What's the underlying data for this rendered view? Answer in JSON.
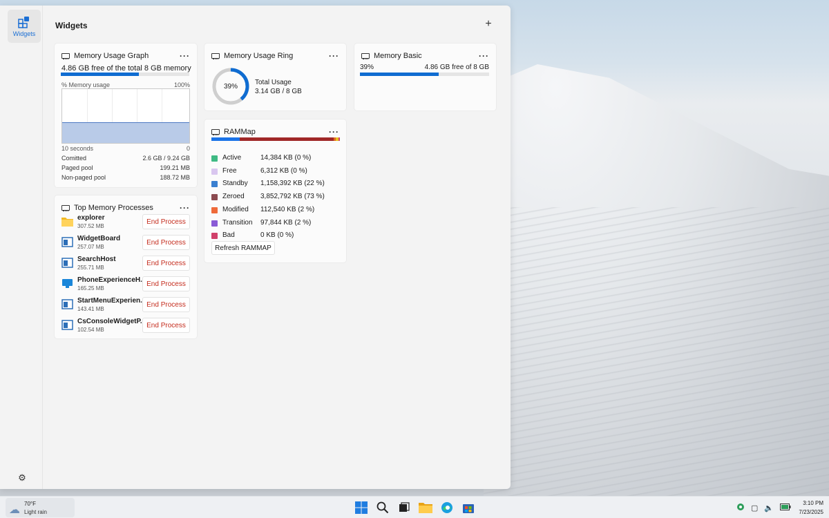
{
  "panel": {
    "title": "Widgets",
    "rail_label": "Widgets",
    "add_icon": "plus-icon",
    "settings_icon": "gear-icon"
  },
  "memory_graph": {
    "title": "Memory Usage Graph",
    "free_text": "4.86 GB free of the total 8 GB memory",
    "used_fraction": 0.61,
    "y_label": "% Memory usage",
    "y_max": "100%",
    "x_label": "10 seconds",
    "x_min": "0",
    "level_percent": 39,
    "stats": [
      {
        "label": "Comitted",
        "value": "2.6 GB / 9.24 GB"
      },
      {
        "label": "Paged pool",
        "value": "199.21 MB"
      },
      {
        "label": "Non-paged pool",
        "value": "188.72 MB"
      }
    ]
  },
  "memory_ring": {
    "title": "Memory Usage Ring",
    "percent_label": "39%",
    "percent": 39,
    "label": "Total Usage",
    "value": "3.14 GB / 8 GB"
  },
  "memory_basic": {
    "title": "Memory Basic",
    "percent_label": "39%",
    "free_text": "4.86 GB free of 8 GB",
    "used_fraction": 0.61
  },
  "top_processes": {
    "title": "Top Memory Processes",
    "end_label": "End Process",
    "items": [
      {
        "name": "explorer",
        "memory": "307.52 MB",
        "icon": "folder-icon"
      },
      {
        "name": "WidgetBoard",
        "memory": "257.07 MB",
        "icon": "app-window-icon"
      },
      {
        "name": "SearchHost",
        "memory": "255.71 MB",
        "icon": "app-window-icon"
      },
      {
        "name": "PhoneExperienceH...",
        "memory": "165.25 MB",
        "icon": "phone-link-icon"
      },
      {
        "name": "StartMenuExperien...",
        "memory": "143.41 MB",
        "icon": "app-window-icon"
      },
      {
        "name": "CsConsoleWidgetP...",
        "memory": "102.54 MB",
        "icon": "app-window-icon"
      }
    ]
  },
  "rammap": {
    "title": "RAMMap",
    "refresh_label": "Refresh RAMMAP",
    "items": [
      {
        "name": "Active",
        "value": "14,384 KB (0 %)",
        "color": "#3fba84",
        "bar_color": "#1a73e8",
        "share": 0.22
      },
      {
        "name": "Free",
        "value": "6,312 KB (0 %)",
        "color": "#d9c6ef",
        "bar_color": "#0020a0",
        "share": 0.0
      },
      {
        "name": "Standby",
        "value": "1,158,392 KB (22 %)",
        "color": "#3a7fd0",
        "bar_color": "#1020c8",
        "share": 0.0
      },
      {
        "name": "Zeroed",
        "value": "3,852,792 KB (73 %)",
        "color": "#8b4a50",
        "bar_color": "#a02828",
        "share": 0.73
      },
      {
        "name": "Modified",
        "value": "112,540 KB (2 %)",
        "color": "#ef6a3a",
        "bar_color": "#e06a20",
        "share": 0.02
      },
      {
        "name": "Transition",
        "value": "97,844 KB (2 %)",
        "color": "#8a5bd6",
        "bar_color": "#e8c020",
        "share": 0.02
      },
      {
        "name": "Bad",
        "value": "0 KB (0 %)",
        "color": "#d0406a",
        "bar_color": "#d0406a",
        "share": 0.01
      }
    ]
  },
  "taskbar": {
    "weather_temp": "70°F",
    "weather_cond": "Light rain",
    "weather_icon": "cloud-rain-icon",
    "time": "3:10 PM",
    "date": "7/23/2025",
    "apps": [
      "windows-start-icon",
      "search-icon",
      "task-view-icon",
      "file-explorer-icon",
      "edge-icon",
      "store-icon"
    ],
    "tray": [
      "security-icon",
      "network-icon",
      "volume-icon",
      "battery-icon"
    ]
  }
}
